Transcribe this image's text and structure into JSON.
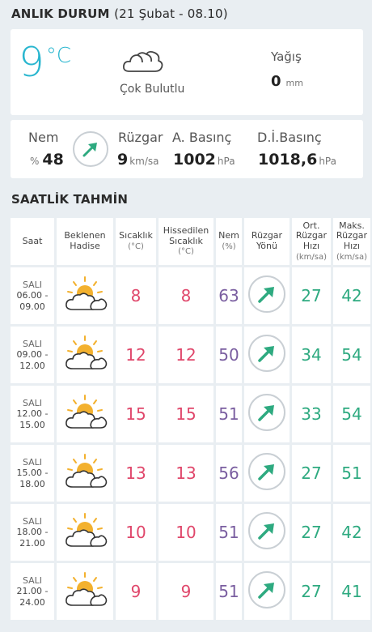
{
  "now": {
    "title": "ANLIK DURUM",
    "subtitle": "(21 Şubat - 08.10)",
    "temperature": "9",
    "temp_unit": "°C",
    "condition": "Çok Bulutlu",
    "condition_icon": "cloud-icon",
    "rain_label": "Yağış",
    "rain_value": "0",
    "rain_unit": "mm"
  },
  "metrics": {
    "humidity_label": "Nem",
    "humidity_prefix": "%",
    "humidity_value": "48",
    "wind_label": "Rüzgar",
    "wind_value": "9",
    "wind_unit": "km/sa",
    "pressure_label": "A. Basınç",
    "pressure_value": "1002",
    "pressure_unit": "hPa",
    "sea_pressure_label": "D.İ.Basınç",
    "sea_pressure_value": "1018,6",
    "sea_pressure_unit": "hPa",
    "arrow_color": "#2eaa80"
  },
  "hourly": {
    "title": "SAATLİK TAHMİN",
    "headers": {
      "time": "Saat",
      "event_1": "Beklenen",
      "event_2": "Hadise",
      "temp_1": "Sıcaklık",
      "temp_2": "(°C)",
      "feels_1": "Hissedilen",
      "feels_2": "Sıcaklık",
      "feels_3": "(°C)",
      "hum_1": "Nem",
      "hum_2": "(%)",
      "winddir_1": "Rüzgar",
      "winddir_2": "Yönü",
      "avg_1": "Ort.",
      "avg_2": "Rüzgar",
      "avg_3": "Hızı",
      "avg_4": "(km/sa)",
      "max_1": "Maks.",
      "max_2": "Rüzgar",
      "max_3": "Hızı",
      "max_4": "(km/sa)"
    },
    "rows": [
      {
        "day": "SALI",
        "start": "06.00 -",
        "end": "09.00",
        "icon": "partly-cloudy-icon",
        "temp": "8",
        "feels": "8",
        "humidity": "63",
        "wind_avg": "27",
        "wind_max": "42"
      },
      {
        "day": "SALI",
        "start": "09.00 -",
        "end": "12.00",
        "icon": "partly-cloudy-icon",
        "temp": "12",
        "feels": "12",
        "humidity": "50",
        "wind_avg": "34",
        "wind_max": "54"
      },
      {
        "day": "SALI",
        "start": "12.00 -",
        "end": "15.00",
        "icon": "partly-cloudy-icon",
        "temp": "15",
        "feels": "15",
        "humidity": "51",
        "wind_avg": "33",
        "wind_max": "54"
      },
      {
        "day": "SALI",
        "start": "15.00 -",
        "end": "18.00",
        "icon": "partly-cloudy-icon",
        "temp": "13",
        "feels": "13",
        "humidity": "56",
        "wind_avg": "27",
        "wind_max": "51"
      },
      {
        "day": "SALI",
        "start": "18.00 -",
        "end": "21.00",
        "icon": "partly-cloudy-icon",
        "temp": "10",
        "feels": "10",
        "humidity": "51",
        "wind_avg": "27",
        "wind_max": "42"
      },
      {
        "day": "SALI",
        "start": "21.00 -",
        "end": "24.00",
        "icon": "partly-cloudy-icon",
        "temp": "9",
        "feels": "9",
        "humidity": "51",
        "wind_avg": "27",
        "wind_max": "41"
      }
    ]
  }
}
